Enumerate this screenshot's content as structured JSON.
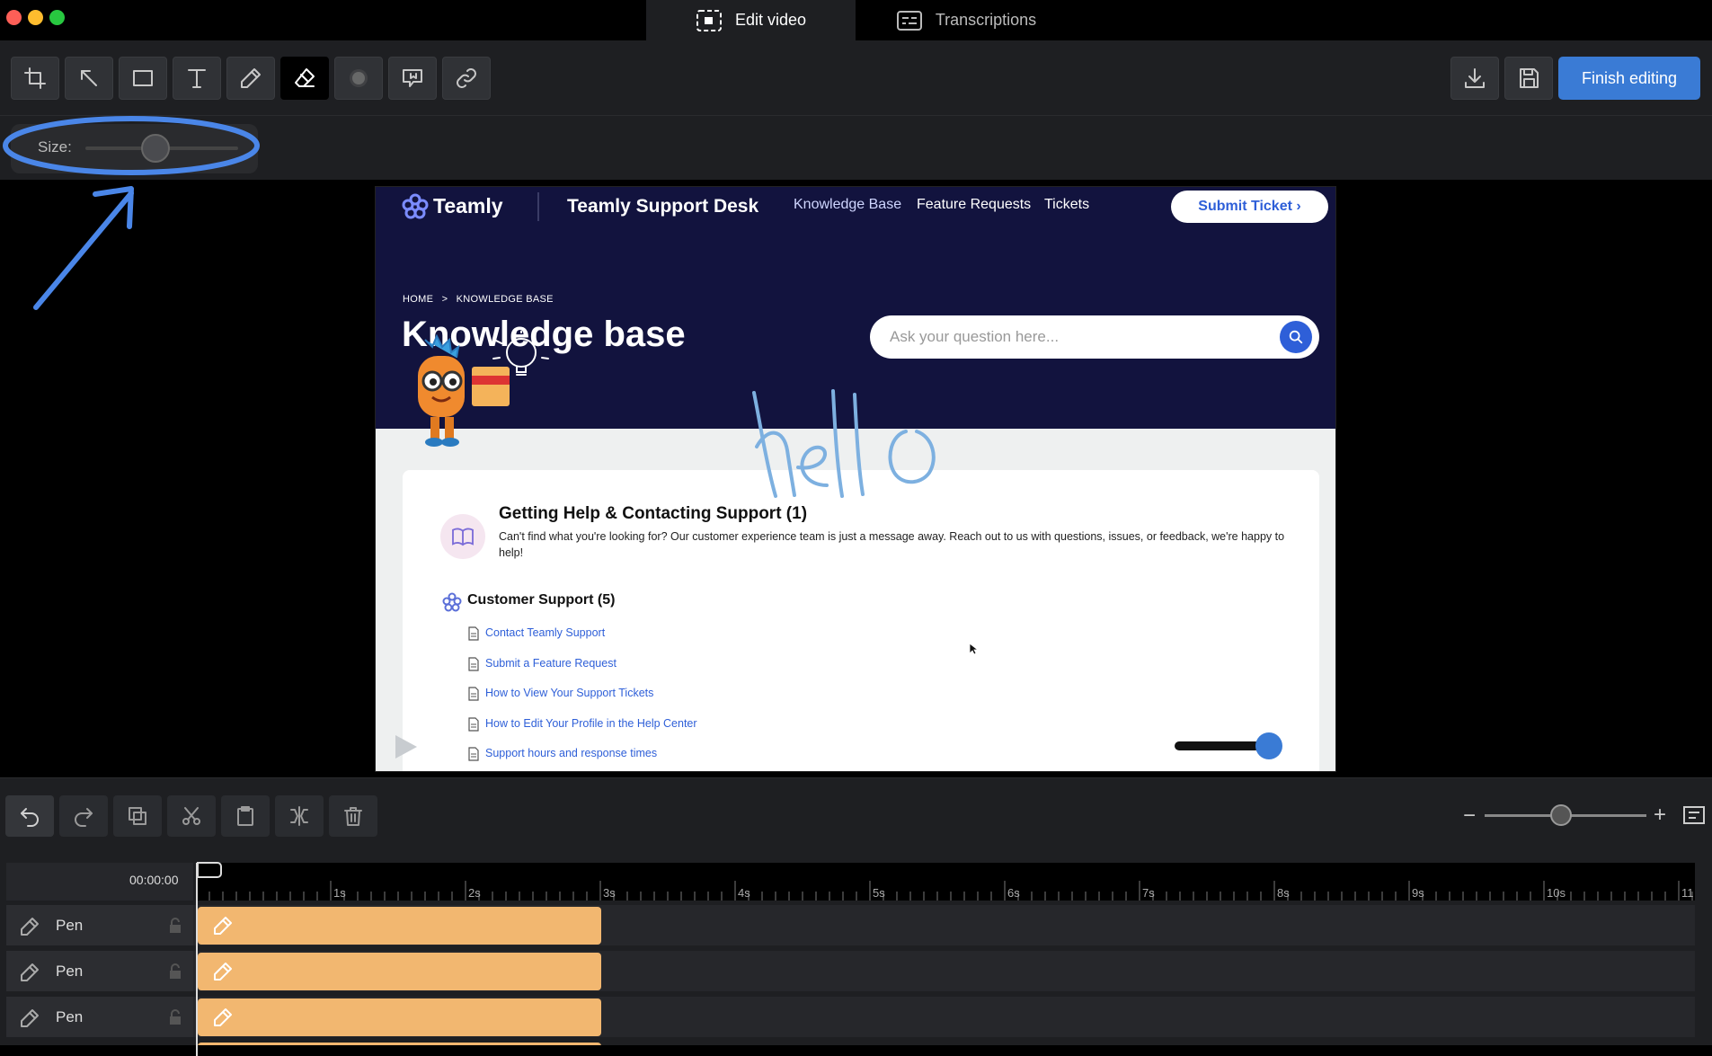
{
  "window": {
    "tabs": [
      {
        "label": "Edit video",
        "active": true
      },
      {
        "label": "Transcriptions",
        "active": false
      }
    ]
  },
  "toolbar": {
    "tools": [
      "crop-icon",
      "arrow-icon",
      "rectangle-icon",
      "text-icon",
      "pen-icon",
      "eraser-icon",
      "blur-icon",
      "callout-icon",
      "link-icon"
    ],
    "active_tool": "eraser-icon",
    "finish_label": "Finish editing"
  },
  "options": {
    "size_label": "Size:"
  },
  "annotation": {
    "handwritten": "hello"
  },
  "video": {
    "brand": "Teamly",
    "desk_title": "Teamly Support Desk",
    "nav": [
      "Knowledge Base",
      "Feature Requests",
      "Tickets"
    ],
    "submit_ticket": "Submit Ticket ›",
    "breadcrumb_home": "HOME",
    "breadcrumb_sep": ">",
    "breadcrumb_current": "KNOWLEDGE BASE",
    "page_title": "Knowledge base",
    "search_placeholder": "Ask your question here...",
    "category_title": "Getting Help & Contacting Support (1)",
    "category_desc": "Can't find what you're looking for? Our customer experience team is just a message away. Reach out to us with questions, issues, or feedback, we're happy to help!",
    "section_title": "Customer Support (5)",
    "articles": [
      "Contact Teamly Support",
      "Submit a Feature Request",
      "How to View Your Support Tickets",
      "How to Edit Your Profile in the Help Center",
      "Support hours and response times"
    ]
  },
  "edit_bar": {
    "buttons": [
      "undo-icon",
      "redo-icon",
      "duplicate-icon",
      "cut-icon",
      "paste-icon",
      "split-icon",
      "delete-icon"
    ],
    "zoom_minus": "−",
    "zoom_plus": "+"
  },
  "timeline": {
    "timecode": "00:00:00",
    "ruler_labels": [
      "1s",
      "2s",
      "3s",
      "4s",
      "5s",
      "6s",
      "7s",
      "8s",
      "9s",
      "10s",
      "11"
    ],
    "tracks": [
      {
        "name": "Pen"
      },
      {
        "name": "Pen"
      },
      {
        "name": "Pen"
      }
    ]
  },
  "colors": {
    "accent": "#3a7bd5",
    "clip": "#f2b770",
    "annotation_blue": "#4a86e8"
  }
}
